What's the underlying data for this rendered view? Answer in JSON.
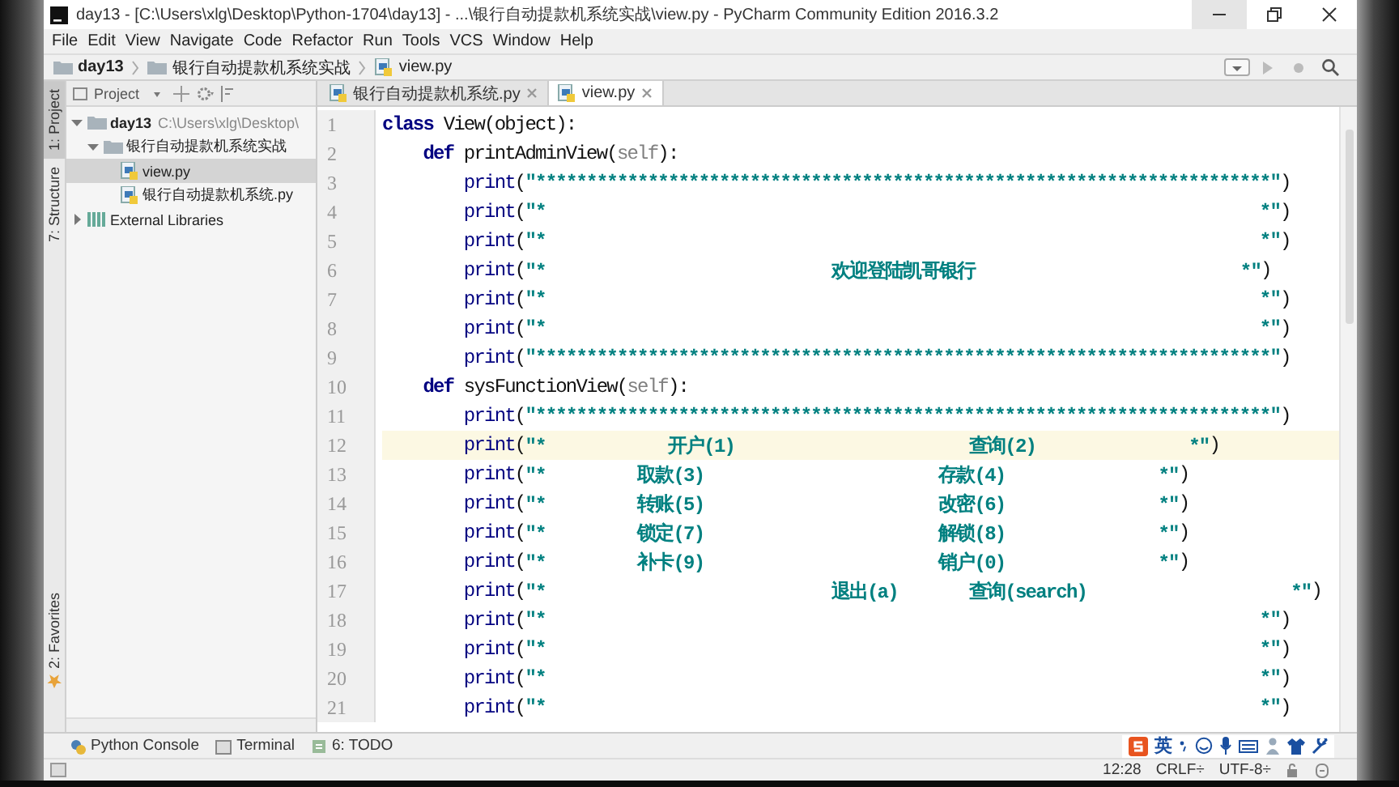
{
  "window": {
    "title": "day13 - [C:\\Users\\xlg\\Desktop\\Python-1704\\day13] - ...\\银行自动提款机系统实战\\view.py - PyCharm Community Edition 2016.3.2"
  },
  "menu": [
    "File",
    "Edit",
    "View",
    "Navigate",
    "Code",
    "Refactor",
    "Run",
    "Tools",
    "VCS",
    "Window",
    "Help"
  ],
  "breadcrumbs": [
    "day13",
    "银行自动提款机系统实战",
    "view.py"
  ],
  "tool_stripe": [
    {
      "label": "1: Project",
      "selected": true
    },
    {
      "label": "7: Structure",
      "selected": false
    }
  ],
  "favorites_tab": {
    "label": "2: Favorites"
  },
  "project_panel": {
    "title": "Project",
    "tree": [
      {
        "label": "day13",
        "path": "C:\\Users\\xlg\\Desktop\\",
        "kind": "folder",
        "selected": false,
        "expanded": true,
        "children": [
          {
            "label": "银行自动提款机系统实战",
            "kind": "folder",
            "selected": false,
            "expanded": true,
            "children": [
              {
                "label": "view.py",
                "kind": "file",
                "selected": true
              },
              {
                "label": "银行自动提款机系统.py",
                "kind": "file",
                "selected": false
              }
            ]
          }
        ]
      },
      {
        "label": "External Libraries",
        "kind": "library",
        "selected": false,
        "expanded": false
      }
    ]
  },
  "editor_tabs": [
    {
      "label": "银行自动提款机系统.py",
      "selected": false
    },
    {
      "label": "view.py",
      "selected": true
    }
  ],
  "editor": {
    "lines": [
      {
        "number": "1",
        "current": false,
        "tokens": [
          {
            "kind": "keyword",
            "text": "class"
          },
          {
            "kind": "plain",
            "text": " View(object):"
          }
        ]
      },
      {
        "number": "2",
        "current": false,
        "tokens": [
          {
            "kind": "keyword",
            "text": "    def"
          },
          {
            "kind": "plain",
            "text": " printAdminView("
          },
          {
            "kind": "self",
            "text": "self"
          },
          {
            "kind": "plain",
            "text": "):"
          }
        ]
      },
      {
        "number": "3",
        "current": false,
        "tokens": [
          {
            "kind": "builtin",
            "text": "        print"
          },
          {
            "kind": "plain",
            "text": "("
          },
          {
            "kind": "string",
            "text": "\"************************************************************************\""
          },
          {
            "kind": "plain",
            "text": ")"
          }
        ]
      },
      {
        "number": "4",
        "current": false,
        "tokens": [
          {
            "kind": "builtin",
            "text": "        print"
          },
          {
            "kind": "plain",
            "text": "("
          },
          {
            "kind": "string",
            "text": "\"*                                                                      *\""
          },
          {
            "kind": "plain",
            "text": ")"
          }
        ]
      },
      {
        "number": "5",
        "current": false,
        "tokens": [
          {
            "kind": "builtin",
            "text": "        print"
          },
          {
            "kind": "plain",
            "text": "("
          },
          {
            "kind": "string",
            "text": "\"*                                                                      *\""
          },
          {
            "kind": "plain",
            "text": ")"
          }
        ]
      },
      {
        "number": "6",
        "current": false,
        "tokens": [
          {
            "kind": "builtin",
            "text": "        print"
          },
          {
            "kind": "plain",
            "text": "("
          },
          {
            "kind": "string",
            "text": "\"*                            欢迎登陆凯哥银行                          *\""
          },
          {
            "kind": "plain",
            "text": ")"
          }
        ]
      },
      {
        "number": "7",
        "current": false,
        "tokens": [
          {
            "kind": "builtin",
            "text": "        print"
          },
          {
            "kind": "plain",
            "text": "("
          },
          {
            "kind": "string",
            "text": "\"*                                                                      *\""
          },
          {
            "kind": "plain",
            "text": ")"
          }
        ]
      },
      {
        "number": "8",
        "current": false,
        "tokens": [
          {
            "kind": "builtin",
            "text": "        print"
          },
          {
            "kind": "plain",
            "text": "("
          },
          {
            "kind": "string",
            "text": "\"*                                                                      *\""
          },
          {
            "kind": "plain",
            "text": ")"
          }
        ]
      },
      {
        "number": "9",
        "current": false,
        "tokens": [
          {
            "kind": "builtin",
            "text": "        print"
          },
          {
            "kind": "plain",
            "text": "("
          },
          {
            "kind": "string",
            "text": "\"************************************************************************\""
          },
          {
            "kind": "plain",
            "text": ")"
          }
        ]
      },
      {
        "number": "10",
        "current": false,
        "tokens": [
          {
            "kind": "keyword",
            "text": "    def"
          },
          {
            "kind": "plain",
            "text": " sysFunctionView("
          },
          {
            "kind": "self",
            "text": "self"
          },
          {
            "kind": "plain",
            "text": "):"
          }
        ]
      },
      {
        "number": "11",
        "current": false,
        "tokens": [
          {
            "kind": "builtin",
            "text": "        print"
          },
          {
            "kind": "plain",
            "text": "("
          },
          {
            "kind": "string",
            "text": "\"************************************************************************\""
          },
          {
            "kind": "plain",
            "text": ")"
          }
        ]
      },
      {
        "number": "12",
        "current": true,
        "tokens": [
          {
            "kind": "builtin",
            "text": "        print"
          },
          {
            "kind": "plain",
            "text": "("
          },
          {
            "kind": "string",
            "text": "\"*            开户(1)                       查询(2)               *\""
          },
          {
            "kind": "plain",
            "text": ")"
          }
        ]
      },
      {
        "number": "13",
        "current": false,
        "tokens": [
          {
            "kind": "builtin",
            "text": "        print"
          },
          {
            "kind": "plain",
            "text": "("
          },
          {
            "kind": "string",
            "text": "\"*         取款(3)                       存款(4)               *\""
          },
          {
            "kind": "plain",
            "text": ")"
          }
        ]
      },
      {
        "number": "14",
        "current": false,
        "tokens": [
          {
            "kind": "builtin",
            "text": "        print"
          },
          {
            "kind": "plain",
            "text": "("
          },
          {
            "kind": "string",
            "text": "\"*         转账(5)                       改密(6)               *\""
          },
          {
            "kind": "plain",
            "text": ")"
          }
        ]
      },
      {
        "number": "15",
        "current": false,
        "tokens": [
          {
            "kind": "builtin",
            "text": "        print"
          },
          {
            "kind": "plain",
            "text": "("
          },
          {
            "kind": "string",
            "text": "\"*         锁定(7)                       解锁(8)               *\""
          },
          {
            "kind": "plain",
            "text": ")"
          }
        ]
      },
      {
        "number": "16",
        "current": false,
        "tokens": [
          {
            "kind": "builtin",
            "text": "        print"
          },
          {
            "kind": "plain",
            "text": "("
          },
          {
            "kind": "string",
            "text": "\"*         补卡(9)                       销户(0)               *\""
          },
          {
            "kind": "plain",
            "text": ")"
          }
        ]
      },
      {
        "number": "17",
        "current": false,
        "tokens": [
          {
            "kind": "builtin",
            "text": "        print"
          },
          {
            "kind": "plain",
            "text": "("
          },
          {
            "kind": "string",
            "text": "\"*                            退出(a)       查询(search)                    *\""
          },
          {
            "kind": "plain",
            "text": ")"
          }
        ]
      },
      {
        "number": "18",
        "current": false,
        "tokens": [
          {
            "kind": "builtin",
            "text": "        print"
          },
          {
            "kind": "plain",
            "text": "("
          },
          {
            "kind": "string",
            "text": "\"*                                                                      *\""
          },
          {
            "kind": "plain",
            "text": ")"
          }
        ]
      },
      {
        "number": "19",
        "current": false,
        "tokens": [
          {
            "kind": "builtin",
            "text": "        print"
          },
          {
            "kind": "plain",
            "text": "("
          },
          {
            "kind": "string",
            "text": "\"*                                                                      *\""
          },
          {
            "kind": "plain",
            "text": ")"
          }
        ]
      },
      {
        "number": "20",
        "current": false,
        "tokens": [
          {
            "kind": "builtin",
            "text": "        print"
          },
          {
            "kind": "plain",
            "text": "("
          },
          {
            "kind": "string",
            "text": "\"*                                                                      *\""
          },
          {
            "kind": "plain",
            "text": ")"
          }
        ]
      },
      {
        "number": "21",
        "current": false,
        "tokens": [
          {
            "kind": "builtin",
            "text": "        print"
          },
          {
            "kind": "plain",
            "text": "("
          },
          {
            "kind": "string",
            "text": "\"*                                                                      *\""
          },
          {
            "kind": "plain",
            "text": ")"
          }
        ]
      }
    ]
  },
  "tool_windows": [
    "Python Console",
    "Terminal",
    "6: TODO"
  ],
  "ime_bar": {
    "mode": "英"
  },
  "status_bar": {
    "position": "12:28",
    "line_separator": "CRLF÷",
    "encoding": "UTF-8÷"
  }
}
